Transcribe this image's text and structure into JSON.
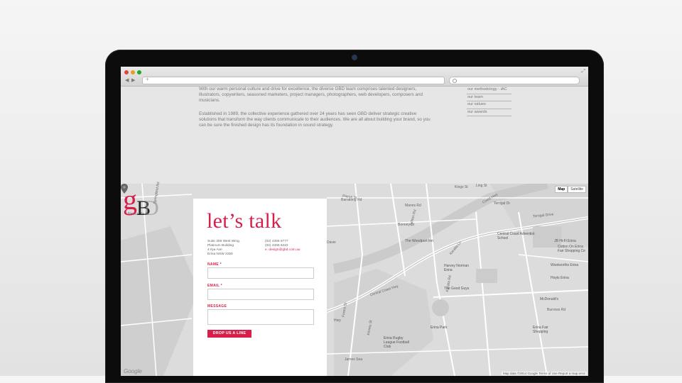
{
  "browser": {
    "back": "◀",
    "forward": "▶",
    "new_tab": "+",
    "expand": "⤢"
  },
  "page": {
    "paragraphs": [
      "With our warm personal culture and drive for excellence, the diverse GBD team comprises talented designers, illustrators, copywriters, seasoned marketers, project managers, photographers, web developers, composers and musicians.",
      "Established in 1989, the collective experience gathered over 24 years has seen GBD deliver strategic creative solutions that transform the way clients communicate to their audiences. We are all about building your brand, so you can be sure the finished design has its foundation in sound strategy."
    ],
    "sidenav": [
      "our methodology - iAC",
      "our team",
      "our values",
      "our awards"
    ]
  },
  "map": {
    "type_buttons": [
      "Map",
      "Satellite"
    ],
    "zoom_in": "+",
    "zoom_out": "−",
    "streets": [
      "Barralong Rd",
      "Terrigal Dr",
      "Terrigal Drive",
      "Pierce St",
      "Central Coast Hwy",
      "Karalta Rd",
      "Karalta Ln",
      "Newcastle St",
      "Springfield Rd",
      "Bonney St",
      "Kings St",
      "Ashton Rd",
      "Davie",
      "Hwy",
      "Kinney St",
      "Forest St",
      "James Sea",
      "Ling St",
      "Coast Hwy",
      "Manns Rd",
      "Burrows Rd"
    ],
    "pois": [
      "The Woodport Inn",
      "Central Coast Adventist School",
      "JB Hi-Fi Erina",
      "Cotton On Erina Fair Shopping Ce",
      "Harvey Norman Erina",
      "Woolworths Erina",
      "Hoyts Erina",
      "The Good Guys",
      "McDonald's",
      "Erina Park",
      "Erina Rugby League Football Club",
      "Erina Fair Shopping"
    ],
    "attribution": "Map data ©2014 Google   Terms of Use   Report a map error",
    "provider": "Google"
  },
  "logo": {
    "g": "g",
    "b": "B",
    "d": "D"
  },
  "contact": {
    "heading": "let’s talk",
    "address": [
      "Suite 306 West Wing,",
      "Platinum Building",
      "4 Ilya Ave",
      "Erina NSW 2250"
    ],
    "phones": [
      "(02) 4365 6777",
      "(02) 4365 6222"
    ],
    "email": "e. design@gbd.com.au",
    "labels": {
      "name": "NAME *",
      "email": "EMAIL *",
      "message": "MESSAGE"
    },
    "submit_label": "DROP US A LINE"
  },
  "colors": {
    "accent": "#d81f4a",
    "map_bg": "#dcdcdc",
    "page_bg": "#e6e6e6"
  }
}
